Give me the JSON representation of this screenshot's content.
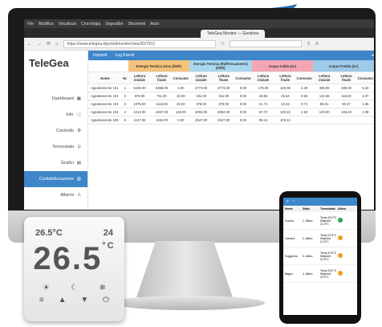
{
  "browser": {
    "menu": [
      "File",
      "Modifica",
      "Visualizza",
      "Cronologia",
      "Segnalibri",
      "Strumenti",
      "Aiuto"
    ],
    "tab_title": "TeleGea Monitor — Gestione",
    "url": "https://www.telegea.it/portal/monitor/view/ID/7912"
  },
  "app": {
    "logo": "TeleGea",
    "topnav": {
      "impianti": "Impianti",
      "log": "Log Eventi"
    },
    "nav": [
      {
        "label": "Dashboard",
        "icon": "dashboard-icon"
      },
      {
        "label": "Info",
        "icon": "info-icon"
      },
      {
        "label": "Controllo",
        "icon": "control-icon"
      },
      {
        "label": "Termostato",
        "icon": "thermostat-icon"
      },
      {
        "label": "Grafici",
        "icon": "chart-icon"
      },
      {
        "label": "Contabilizzazione",
        "icon": "meter-icon"
      },
      {
        "label": "Allarmi",
        "icon": "warning-icon"
      }
    ],
    "groups": [
      "Energia Termica Zona (kWh)",
      "Energia Termica (Raffrescamento) (kWh)",
      "Acqua Calda (m³)",
      "Acqua Fredda (m³)"
    ],
    "columns": [
      "Nome",
      "Nr.",
      "Lettura iniziale",
      "Lettura finale",
      "Consumo",
      "Lettura iniziale",
      "Lettura finale",
      "Consumo",
      "Lettura iniziale",
      "Lettura finale",
      "Consumo",
      "Lettura iniziale",
      "Lettura finale",
      "Consumo"
    ],
    "rows": [
      [
        "Appartamento 101",
        "1",
        "5165.00",
        "5368.00",
        "3.00",
        "2773.00",
        "2773.00",
        "0.00",
        "179.00",
        "183.36",
        "4.49",
        "305.05",
        "308.00",
        "5.22"
      ],
      [
        "Appartamento 102",
        "2",
        "679.00",
        "711.00",
        "32.00",
        "331.00",
        "331.00",
        "0.00",
        "49.65",
        "45.54",
        "0.59",
        "112.65",
        "116.02",
        "3.37"
      ],
      [
        "Appartamento 103",
        "3",
        "1075.00",
        "1118.00",
        "33.00",
        "378.00",
        "378.00",
        "0.00",
        "21.71",
        "22.43",
        "0.71",
        "88.01",
        "90.37",
        "1.55"
      ],
      [
        "Appartamento 104",
        "4",
        "4212.00",
        "4357.00",
        "145.00",
        "4094.00",
        "4094.00",
        "0.00",
        "97.72",
        "100.22",
        "2.50",
        "103.00",
        "106.20",
        "1.09"
      ],
      [
        "Appartamento 105",
        "5",
        "1147.00",
        "1194.00",
        "0.00",
        "2547.00",
        "2547.00",
        "0.00",
        "99.41",
        "100.12",
        "",
        "",
        "",
        ""
      ]
    ]
  },
  "thermostat": {
    "setpoint": "26.5",
    "setpoint_unit": "°C",
    "outside": "24",
    "temperature": "26.5",
    "unit": "°C",
    "keys": [
      "≡",
      "▲",
      "▼",
      "⏻"
    ]
  },
  "phone": {
    "headers": [
      "Nome",
      "Stato",
      "Termostato",
      "Attivo"
    ],
    "rows": [
      {
        "name": "Cucina",
        "state": "1. Attivo",
        "desc": "Temp 22.0°C Setpoint 21.0°C",
        "color": "#2aa84a"
      },
      {
        "name": "Camera",
        "state": "2. Attivo",
        "desc": "Temp 21.5°C Setpoint 21.0°C",
        "color": "#f0a020"
      },
      {
        "name": "Soggiorno",
        "state": "3. Attivo",
        "desc": "Temp 20.5°C Setpoint 21.0°C",
        "color": "#f0a020"
      },
      {
        "name": "Bagno",
        "state": "4. Attivo",
        "desc": "Temp 23.0°C Setpoint 22.0°C",
        "color": "#f0a020"
      }
    ]
  }
}
